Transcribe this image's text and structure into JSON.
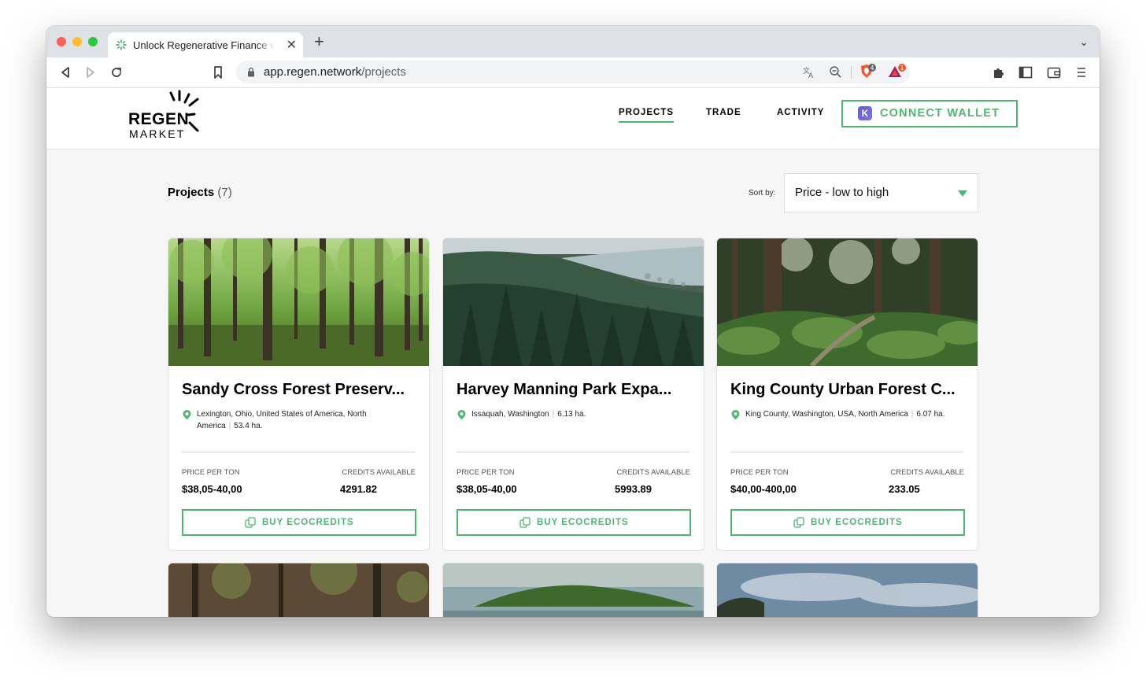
{
  "browser": {
    "tab_title": "Unlock Regenerative Finance w",
    "url_host": "app.regen.network",
    "url_path": "/projects",
    "badges": {
      "brave": "4",
      "bat": "1"
    }
  },
  "site": {
    "logo_line1": "REGEN",
    "logo_line2": "MARKET",
    "nav": [
      "PROJECTS",
      "TRADE",
      "ACTIVITY"
    ],
    "active_nav": "PROJECTS",
    "connect_label": "CONNECT WALLET",
    "connect_icon_letter": "K"
  },
  "listing": {
    "title": "Projects",
    "count": "(7)",
    "sort_label": "Sort by:",
    "sort_value": "Price - low to high"
  },
  "labels": {
    "price": "PRICE PER TON",
    "credits": "CREDITS AVAILABLE",
    "buy": "BUY ECOCREDITS"
  },
  "cards": [
    {
      "title": "Sandy Cross Forest Preserv...",
      "location": "Lexington, Ohio, United States of America, North America",
      "area": "53.4 ha.",
      "price": "$38,05-40,00",
      "credits": "4291.82"
    },
    {
      "title": "Harvey Manning Park Expa...",
      "location": "Issaquah, Washington",
      "area": "6.13 ha.",
      "price": "$38,05-40,00",
      "credits": "5993.89"
    },
    {
      "title": "King County Urban Forest C...",
      "location": "King County, Washington, USA, North America",
      "area": "6.07 ha.",
      "price": "$40,00-400,00",
      "credits": "233.05"
    }
  ],
  "colors": {
    "accent": "#4fb573",
    "text": "#000000",
    "page_bg": "#f6f6f6"
  }
}
